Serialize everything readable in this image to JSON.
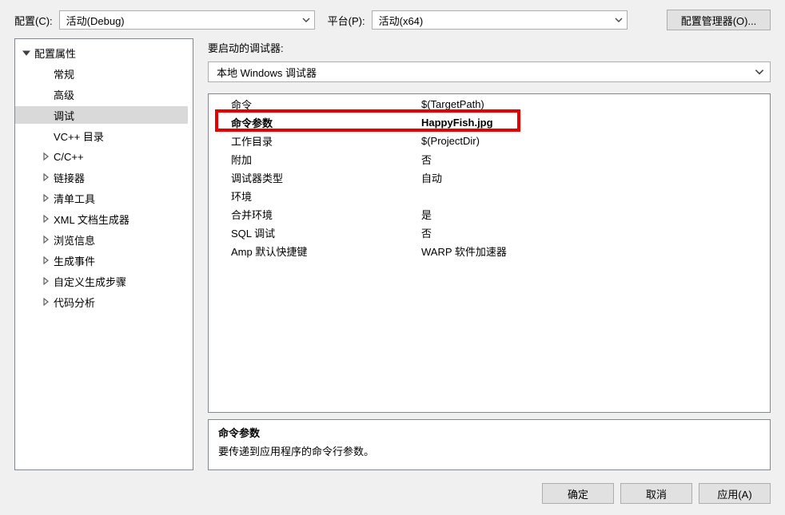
{
  "toolbar": {
    "config_label": "配置(C):",
    "config_value": "活动(Debug)",
    "platform_label": "平台(P):",
    "platform_value": "活动(x64)",
    "cfgmgr_label": "配置管理器(O)..."
  },
  "tree": {
    "root": "配置属性",
    "items": [
      {
        "label": "常规",
        "expandable": false
      },
      {
        "label": "高级",
        "expandable": false
      },
      {
        "label": "调试",
        "expandable": false,
        "selected": true
      },
      {
        "label": "VC++ 目录",
        "expandable": false
      },
      {
        "label": "C/C++",
        "expandable": true
      },
      {
        "label": "链接器",
        "expandable": true
      },
      {
        "label": "清单工具",
        "expandable": true
      },
      {
        "label": "XML 文档生成器",
        "expandable": true
      },
      {
        "label": "浏览信息",
        "expandable": true
      },
      {
        "label": "生成事件",
        "expandable": true
      },
      {
        "label": "自定义生成步骤",
        "expandable": true
      },
      {
        "label": "代码分析",
        "expandable": true
      }
    ]
  },
  "right": {
    "launch_label": "要启动的调试器:",
    "debugger_value": "本地 Windows 调试器"
  },
  "props": [
    {
      "name": "命令",
      "value": "$(TargetPath)"
    },
    {
      "name": "命令参数",
      "value": "HappyFish.jpg",
      "bold": true,
      "highlighted": true
    },
    {
      "name": "工作目录",
      "value": "$(ProjectDir)"
    },
    {
      "name": "附加",
      "value": "否"
    },
    {
      "name": "调试器类型",
      "value": "自动"
    },
    {
      "name": "环境",
      "value": ""
    },
    {
      "name": "合并环境",
      "value": "是"
    },
    {
      "name": "SQL 调试",
      "value": "否"
    },
    {
      "name": "Amp 默认快捷键",
      "value": "WARP 软件加速器"
    }
  ],
  "desc": {
    "title": "命令参数",
    "text": "要传递到应用程序的命令行参数。"
  },
  "buttons": {
    "ok": "确定",
    "cancel": "取消",
    "apply": "应用(A)"
  }
}
